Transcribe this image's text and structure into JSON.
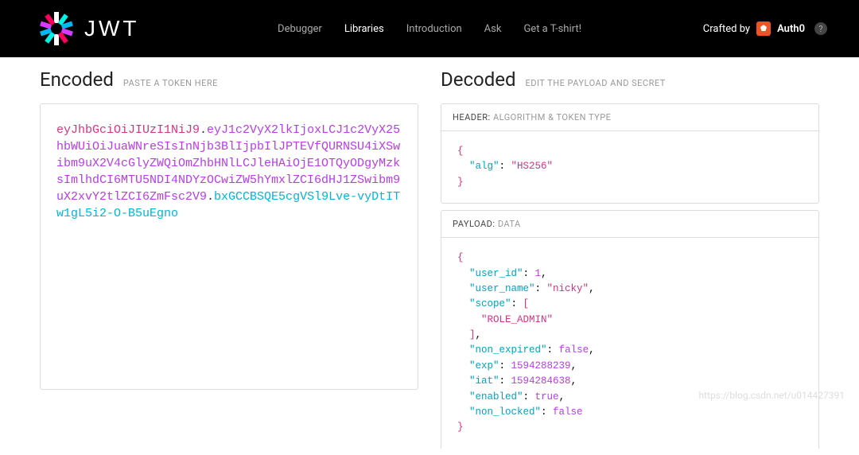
{
  "brand": {
    "text": "JWT"
  },
  "nav": {
    "debugger": "Debugger",
    "libraries": "Libraries",
    "introduction": "Introduction",
    "ask": "Ask",
    "tshirt": "Get a T-shirt!"
  },
  "crafted_by": "Crafted by",
  "auth0": "Auth0",
  "encoded": {
    "title": "Encoded",
    "hint": "PASTE A TOKEN HERE",
    "token_header": "eyJhbGciOiJIUzI1NiJ9",
    "token_payload": "eyJ1c2VyX2lkIjoxLCJ1c2VyX25hbWUiOiJuaWNreSIsInNjb3BlIjpbIlJPTEVfQURNSU4iXSwibm9uX2V4cGlyZWQiOmZhbHNlLCJleHAiOjE1OTQyODgyMzksImlhdCI6MTU5NDI4NDYzOCwiZW5hYmxlZCI6dHJ1ZSwibm9uX2xvY2tlZCI6ZmFsc2V9",
    "token_sig": "bxGCCBSQE5cgVSl9Lve-vyDtITw1gL5i2-O-B5uEgno"
  },
  "decoded": {
    "title": "Decoded",
    "hint": "EDIT THE PAYLOAD AND SECRET",
    "header_label": "HEADER:",
    "header_sub": "ALGORITHM & TOKEN TYPE",
    "payload_label": "PAYLOAD:",
    "payload_sub": "DATA",
    "header_json": {
      "alg": "HS256"
    },
    "payload_json": {
      "user_id": 1,
      "user_name": "nicky",
      "scope": [
        "ROLE_ADMIN"
      ],
      "non_expired": false,
      "exp": 1594288239,
      "iat": 1594284638,
      "enabled": true,
      "non_locked": false
    }
  },
  "watermark": "https://blog.csdn.net/u014427391"
}
